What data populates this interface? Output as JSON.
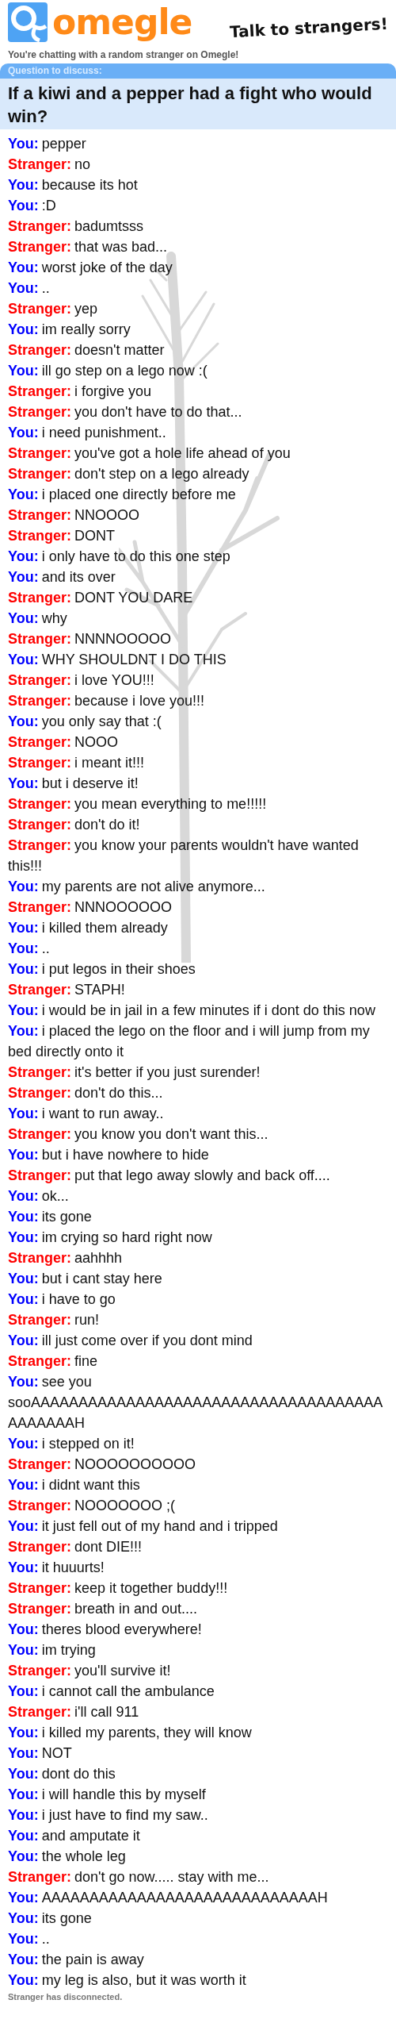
{
  "header": {
    "logo": "omegle",
    "tagline": "Talk to strangers!"
  },
  "status": "You're chatting with a random stranger on Omegle!",
  "question": {
    "label": "Question to discuss:",
    "text": "If a kiwi and a pepper had a fight who would win?"
  },
  "messages": [
    {
      "kind": "you",
      "speaker": "You:",
      "text": "pepper"
    },
    {
      "kind": "stranger",
      "speaker": "Stranger:",
      "text": "no"
    },
    {
      "kind": "you",
      "speaker": "You:",
      "text": "because its hot"
    },
    {
      "kind": "you",
      "speaker": "You:",
      "text": ":D"
    },
    {
      "kind": "stranger",
      "speaker": "Stranger:",
      "text": "badumtsss"
    },
    {
      "kind": "stranger",
      "speaker": "Stranger:",
      "text": "that was bad..."
    },
    {
      "kind": "you",
      "speaker": "You:",
      "text": "worst joke of the day"
    },
    {
      "kind": "you",
      "speaker": "You:",
      "text": ".."
    },
    {
      "kind": "stranger",
      "speaker": "Stranger:",
      "text": "yep"
    },
    {
      "kind": "you",
      "speaker": "You:",
      "text": "im really sorry"
    },
    {
      "kind": "stranger",
      "speaker": "Stranger:",
      "text": "doesn't matter"
    },
    {
      "kind": "you",
      "speaker": "You:",
      "text": "ill go step on a lego now :("
    },
    {
      "kind": "stranger",
      "speaker": "Stranger:",
      "text": "i forgive you"
    },
    {
      "kind": "stranger",
      "speaker": "Stranger:",
      "text": "you don't have to do that..."
    },
    {
      "kind": "you",
      "speaker": "You:",
      "text": "i need punishment.."
    },
    {
      "kind": "stranger",
      "speaker": "Stranger:",
      "text": "you've got a hole life ahead of you"
    },
    {
      "kind": "stranger",
      "speaker": "Stranger:",
      "text": "don't step on a lego already"
    },
    {
      "kind": "you",
      "speaker": "You:",
      "text": "i placed one directly before me"
    },
    {
      "kind": "stranger",
      "speaker": "Stranger:",
      "text": "NNOOOO"
    },
    {
      "kind": "stranger",
      "speaker": "Stranger:",
      "text": "DONT"
    },
    {
      "kind": "you",
      "speaker": "You:",
      "text": "i only have to do this one step"
    },
    {
      "kind": "you",
      "speaker": "You:",
      "text": "and its over"
    },
    {
      "kind": "stranger",
      "speaker": "Stranger:",
      "text": "DONT YOU DARE"
    },
    {
      "kind": "you",
      "speaker": "You:",
      "text": "why"
    },
    {
      "kind": "stranger",
      "speaker": "Stranger:",
      "text": "NNNNOOOOO"
    },
    {
      "kind": "you",
      "speaker": "You:",
      "text": "WHY SHOULDNT I DO THIS"
    },
    {
      "kind": "stranger",
      "speaker": "Stranger:",
      "text": "i love YOU!!!"
    },
    {
      "kind": "stranger",
      "speaker": "Stranger:",
      "text": "because i love you!!!"
    },
    {
      "kind": "you",
      "speaker": "You:",
      "text": "you only say that :("
    },
    {
      "kind": "stranger",
      "speaker": "Stranger:",
      "text": "NOOO"
    },
    {
      "kind": "stranger",
      "speaker": "Stranger:",
      "text": "i meant it!!!"
    },
    {
      "kind": "you",
      "speaker": "You:",
      "text": "but i deserve it!"
    },
    {
      "kind": "stranger",
      "speaker": "Stranger:",
      "text": "you mean everything to me!!!!!"
    },
    {
      "kind": "stranger",
      "speaker": "Stranger:",
      "text": "don't do it!"
    },
    {
      "kind": "stranger",
      "speaker": "Stranger:",
      "text": "you know your parents wouldn't have wanted this!!!"
    },
    {
      "kind": "you",
      "speaker": "You:",
      "text": "my parents are not alive anymore..."
    },
    {
      "kind": "stranger",
      "speaker": "Stranger:",
      "text": "NNNOOOOOO"
    },
    {
      "kind": "you",
      "speaker": "You:",
      "text": "i killed them already"
    },
    {
      "kind": "you",
      "speaker": "You:",
      "text": ".."
    },
    {
      "kind": "you",
      "speaker": "You:",
      "text": "i put legos in their shoes"
    },
    {
      "kind": "stranger",
      "speaker": "Stranger:",
      "text": "STAPH!"
    },
    {
      "kind": "you",
      "speaker": "You:",
      "text": "i would be in jail in a few minutes if i dont do this now"
    },
    {
      "kind": "you",
      "speaker": "You:",
      "text": "i placed the lego on the floor and i will jump from my bed directly onto it"
    },
    {
      "kind": "stranger",
      "speaker": "Stranger:",
      "text": "it's better if you just surender!"
    },
    {
      "kind": "stranger",
      "speaker": "Stranger:",
      "text": "don't do this..."
    },
    {
      "kind": "you",
      "speaker": "You:",
      "text": "i want to run away.."
    },
    {
      "kind": "stranger",
      "speaker": "Stranger:",
      "text": "you know you don't want this..."
    },
    {
      "kind": "you",
      "speaker": "You:",
      "text": "but i have nowhere to hide"
    },
    {
      "kind": "stranger",
      "speaker": "Stranger:",
      "text": "put that lego away slowly and back off...."
    },
    {
      "kind": "you",
      "speaker": "You:",
      "text": "ok..."
    },
    {
      "kind": "you",
      "speaker": "You:",
      "text": "its gone"
    },
    {
      "kind": "you",
      "speaker": "You:",
      "text": "im crying so hard right now"
    },
    {
      "kind": "stranger",
      "speaker": "Stranger:",
      "text": "aahhhh"
    },
    {
      "kind": "you",
      "speaker": "You:",
      "text": "but i cant stay here"
    },
    {
      "kind": "you",
      "speaker": "You:",
      "text": "i have to go"
    },
    {
      "kind": "stranger",
      "speaker": "Stranger:",
      "text": "run!"
    },
    {
      "kind": "you",
      "speaker": "You:",
      "text": "ill just come over if you dont mind"
    },
    {
      "kind": "stranger",
      "speaker": "Stranger:",
      "text": "fine"
    },
    {
      "kind": "you",
      "speaker": "You:",
      "text": "see you sooAAAAAAAAAAAAAAAAAAAAAAAAAAAAAAAAAAAAAAAAAAAAH"
    },
    {
      "kind": "you",
      "speaker": "You:",
      "text": "i stepped on it!"
    },
    {
      "kind": "stranger",
      "speaker": "Stranger:",
      "text": "NOOOOOOOOOO"
    },
    {
      "kind": "you",
      "speaker": "You:",
      "text": "i didnt want this"
    },
    {
      "kind": "stranger",
      "speaker": "Stranger:",
      "text": "NOOOOOOO ;("
    },
    {
      "kind": "you",
      "speaker": "You:",
      "text": "it just fell out of my hand and i tripped"
    },
    {
      "kind": "stranger",
      "speaker": "Stranger:",
      "text": "dont DIE!!!"
    },
    {
      "kind": "you",
      "speaker": "You:",
      "text": "it huuurts!"
    },
    {
      "kind": "stranger",
      "speaker": "Stranger:",
      "text": "keep it together buddy!!!"
    },
    {
      "kind": "stranger",
      "speaker": "Stranger:",
      "text": "breath in and out...."
    },
    {
      "kind": "you",
      "speaker": "You:",
      "text": "theres blood everywhere!"
    },
    {
      "kind": "you",
      "speaker": "You:",
      "text": "im trying"
    },
    {
      "kind": "stranger",
      "speaker": "Stranger:",
      "text": "you'll survive it!"
    },
    {
      "kind": "you",
      "speaker": "You:",
      "text": "i cannot call the ambulance"
    },
    {
      "kind": "stranger",
      "speaker": "Stranger:",
      "text": "i'll call 911"
    },
    {
      "kind": "you",
      "speaker": "You:",
      "text": "i killed my parents, they will know"
    },
    {
      "kind": "you",
      "speaker": "You:",
      "text": "NOT"
    },
    {
      "kind": "you",
      "speaker": "You:",
      "text": "dont do this"
    },
    {
      "kind": "you",
      "speaker": "You:",
      "text": "i will handle this by myself"
    },
    {
      "kind": "you",
      "speaker": "You:",
      "text": "i just have to find my saw.."
    },
    {
      "kind": "you",
      "speaker": "You:",
      "text": "and amputate it"
    },
    {
      "kind": "you",
      "speaker": "You:",
      "text": "the whole leg"
    },
    {
      "kind": "stranger",
      "speaker": "Stranger:",
      "text": "don't go now..... stay with  me..."
    },
    {
      "kind": "you",
      "speaker": "You:",
      "text": "AAAAAAAAAAAAAAAAAAAAAAAAAAAAAH"
    },
    {
      "kind": "you",
      "speaker": "You:",
      "text": "its gone"
    },
    {
      "kind": "you",
      "speaker": "You:",
      "text": ".."
    },
    {
      "kind": "you",
      "speaker": "You:",
      "text": "the pain is away"
    },
    {
      "kind": "you",
      "speaker": "You:",
      "text": "my leg is also, but it was worth it"
    }
  ],
  "notice": "Stranger has disconnected."
}
